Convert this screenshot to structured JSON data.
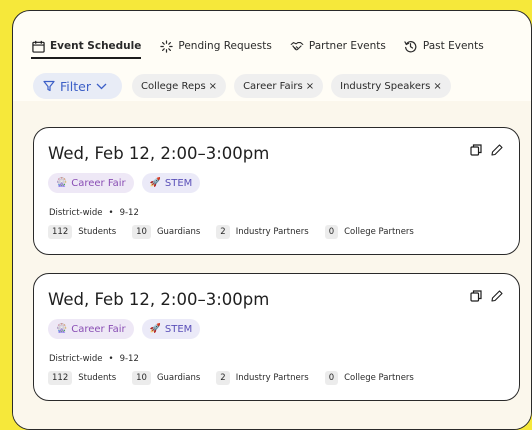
{
  "tabs": [
    {
      "label": "Event Schedule",
      "icon": "calendar-icon",
      "active": true
    },
    {
      "label": "Pending Requests",
      "icon": "loading-icon",
      "active": false
    },
    {
      "label": "Partner Events",
      "icon": "handshake-icon",
      "active": false
    },
    {
      "label": "Past Events",
      "icon": "history-icon",
      "active": false
    }
  ],
  "filter": {
    "label": "Filter",
    "color": "#3c5fc7"
  },
  "chips": [
    {
      "label": "College Reps"
    },
    {
      "label": "Career Fairs"
    },
    {
      "label": "Industry Speakers"
    }
  ],
  "chip_remove_glyph": "×",
  "events": [
    {
      "title": "Wed, Feb 12, 2:00–3:00pm",
      "tags": [
        {
          "label": "Career Fair",
          "icon": "ferris-wheel-icon",
          "glyph": "🎡"
        },
        {
          "label": "STEM",
          "icon": "rocket-icon",
          "glyph": "🚀"
        }
      ],
      "location": "District-wide",
      "grades": "9-12",
      "stats": [
        {
          "count": "112",
          "label": "Students"
        },
        {
          "count": "10",
          "label": "Guardians"
        },
        {
          "count": "2",
          "label": "Industry Partners"
        },
        {
          "count": "0",
          "label": "College Partners"
        }
      ]
    },
    {
      "title": "Wed, Feb 12, 2:00–3:00pm",
      "tags": [
        {
          "label": "Career Fair",
          "icon": "ferris-wheel-icon",
          "glyph": "🎡"
        },
        {
          "label": "STEM",
          "icon": "rocket-icon",
          "glyph": "🚀"
        }
      ],
      "location": "District-wide",
      "grades": "9-12",
      "stats": [
        {
          "count": "112",
          "label": "Students"
        },
        {
          "count": "10",
          "label": "Guardians"
        },
        {
          "count": "2",
          "label": "Industry Partners"
        },
        {
          "count": "0",
          "label": "College Partners"
        }
      ]
    }
  ],
  "meta_separator": "•",
  "colors": {
    "background": "#f6e83a",
    "accent": "#3c5fc7",
    "career_tag": "#8a4fb5",
    "stem_tag": "#5a4fb8"
  }
}
